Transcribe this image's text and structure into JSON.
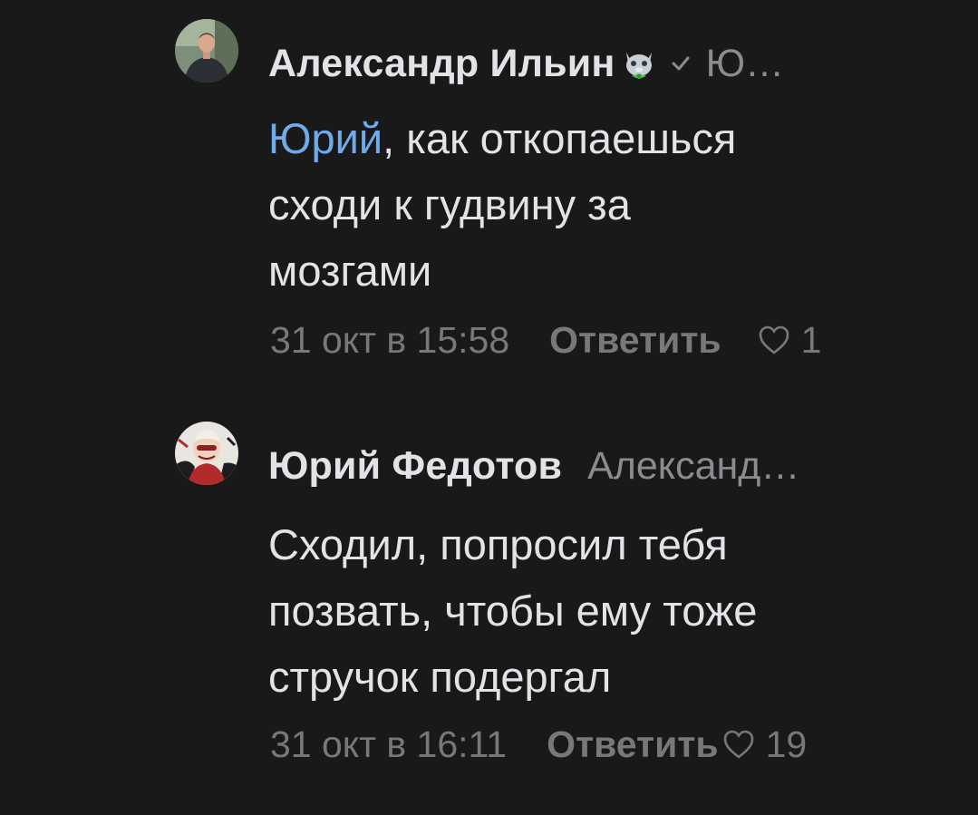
{
  "comments": [
    {
      "author": "Александр Ильин",
      "reply_to": "Ю…",
      "mention": "Юрий",
      "text_line1_rest": ", как откопаешься",
      "text_line2": "сходи к гудвину за",
      "text_line3": "мозгами",
      "date": "31 окт в 15:58",
      "reply_label": "Ответить",
      "likes": "1",
      "avatar_icon": "user-photo-avatar",
      "badges": [
        "cat-emoji-badge",
        "verified-check-icon"
      ]
    },
    {
      "author": "Юрий Федотов",
      "reply_to": "Александ…",
      "text_line1": "Сходил, попросил тебя",
      "text_line2": "позвать, чтобы ему тоже",
      "text_line3": "стручок подергал",
      "date": "31 окт в 16:11",
      "reply_label": "Ответить",
      "likes": "19",
      "avatar_icon": "anime-character-avatar"
    }
  ],
  "colors": {
    "background": "#191919",
    "primary_text": "#e1e3e6",
    "secondary_text": "#76787a",
    "mention": "#71aaeb"
  }
}
